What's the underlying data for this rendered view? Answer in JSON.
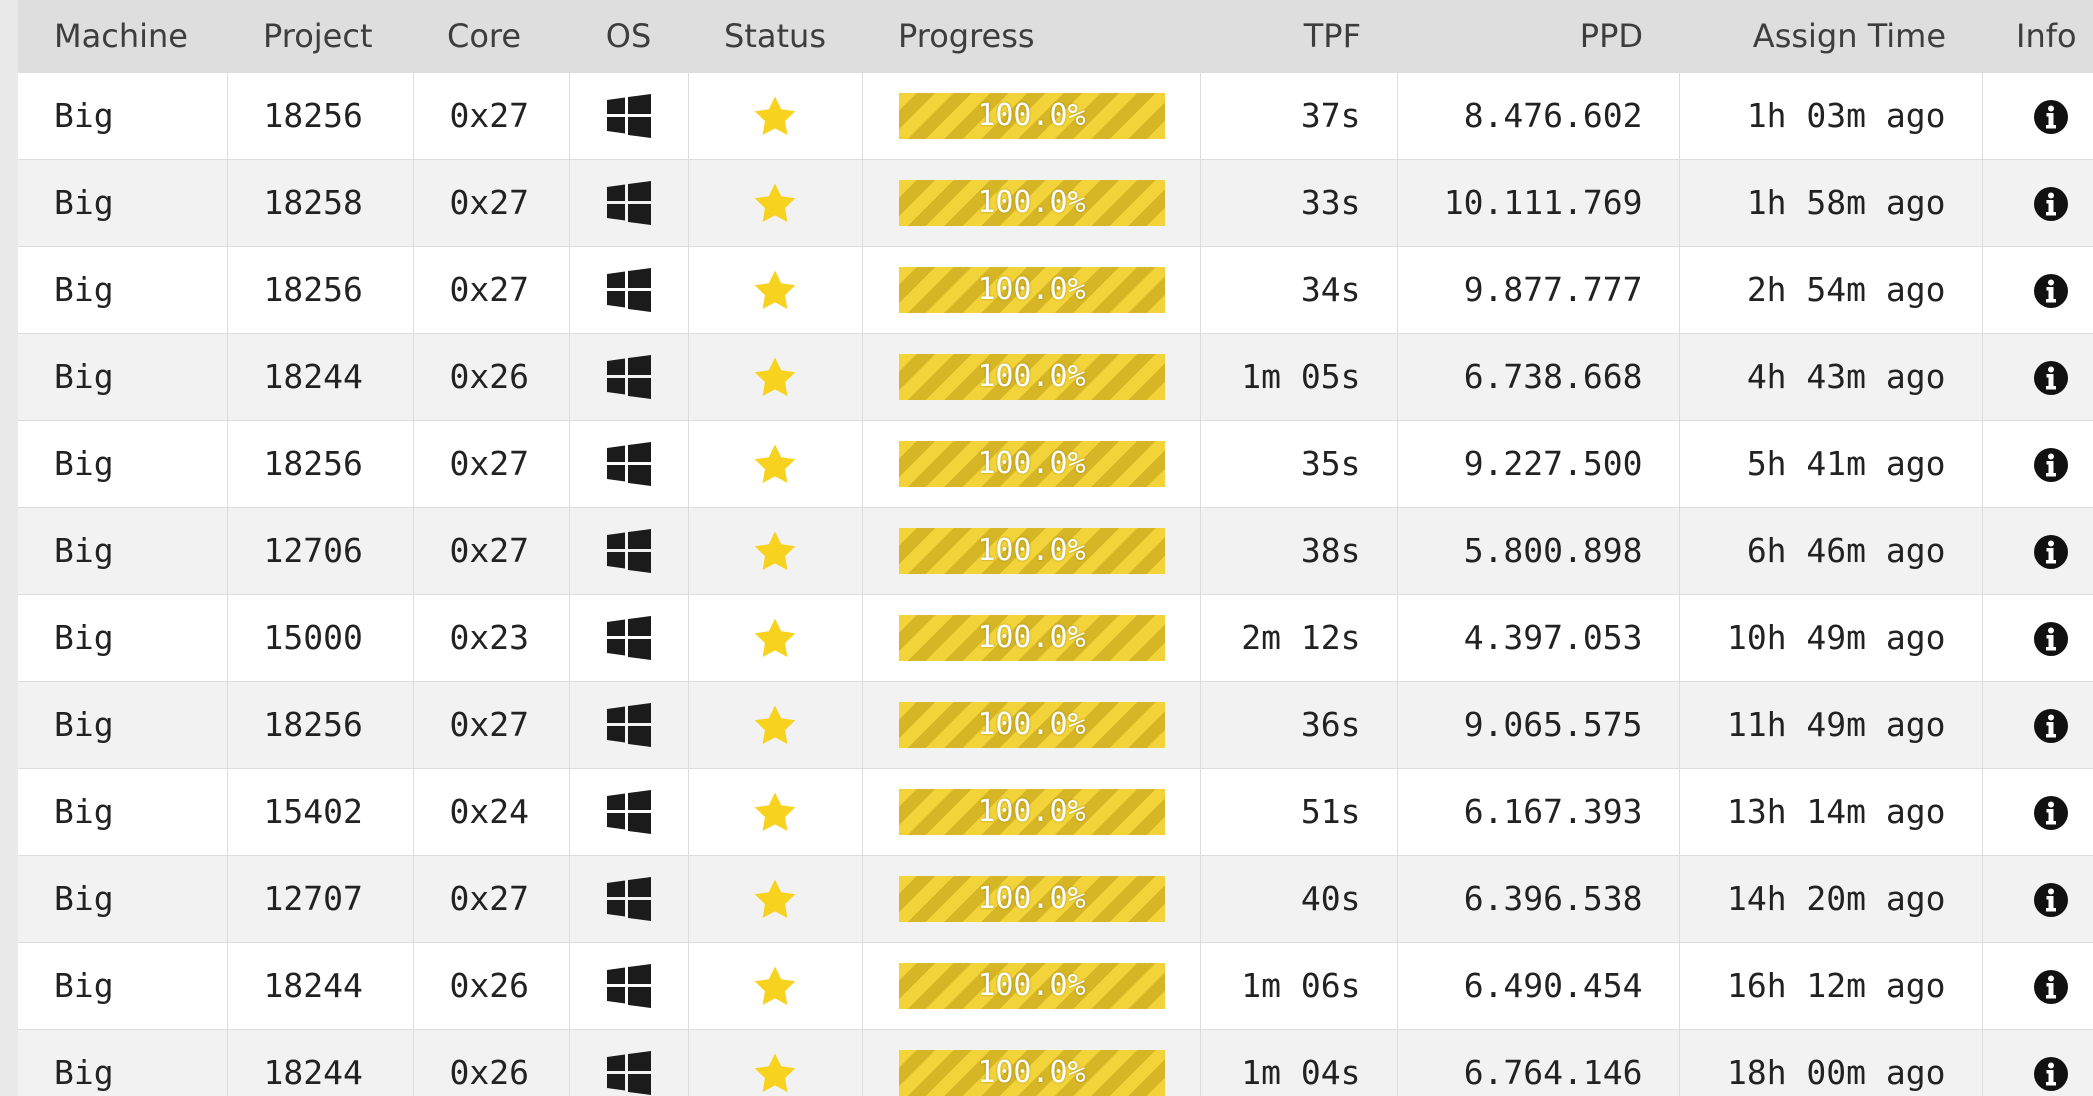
{
  "columns": {
    "machine": "Machine",
    "project": "Project",
    "core": "Core",
    "os": "OS",
    "status": "Status",
    "progress": "Progress",
    "tpf": "TPF",
    "ppd": "PPD",
    "assign_time": "Assign Time",
    "info": "Info"
  },
  "icons": {
    "os": "windows-icon",
    "status": "star-icon",
    "info": "info-icon"
  },
  "colors": {
    "star": "#f7d21e",
    "progress_light": "#f2d43a",
    "progress_dark": "#d6b625"
  },
  "rows": [
    {
      "machine": "Big",
      "project": "18256",
      "core": "0x27",
      "progress": "100.0%",
      "progress_value": 100,
      "tpf": "37s",
      "ppd": "8.476.602",
      "assign_time": "1h 03m ago"
    },
    {
      "machine": "Big",
      "project": "18258",
      "core": "0x27",
      "progress": "100.0%",
      "progress_value": 100,
      "tpf": "33s",
      "ppd": "10.111.769",
      "assign_time": "1h 58m ago"
    },
    {
      "machine": "Big",
      "project": "18256",
      "core": "0x27",
      "progress": "100.0%",
      "progress_value": 100,
      "tpf": "34s",
      "ppd": "9.877.777",
      "assign_time": "2h 54m ago"
    },
    {
      "machine": "Big",
      "project": "18244",
      "core": "0x26",
      "progress": "100.0%",
      "progress_value": 100,
      "tpf": "1m 05s",
      "ppd": "6.738.668",
      "assign_time": "4h 43m ago"
    },
    {
      "machine": "Big",
      "project": "18256",
      "core": "0x27",
      "progress": "100.0%",
      "progress_value": 100,
      "tpf": "35s",
      "ppd": "9.227.500",
      "assign_time": "5h 41m ago"
    },
    {
      "machine": "Big",
      "project": "12706",
      "core": "0x27",
      "progress": "100.0%",
      "progress_value": 100,
      "tpf": "38s",
      "ppd": "5.800.898",
      "assign_time": "6h 46m ago"
    },
    {
      "machine": "Big",
      "project": "15000",
      "core": "0x23",
      "progress": "100.0%",
      "progress_value": 100,
      "tpf": "2m 12s",
      "ppd": "4.397.053",
      "assign_time": "10h 49m ago"
    },
    {
      "machine": "Big",
      "project": "18256",
      "core": "0x27",
      "progress": "100.0%",
      "progress_value": 100,
      "tpf": "36s",
      "ppd": "9.065.575",
      "assign_time": "11h 49m ago"
    },
    {
      "machine": "Big",
      "project": "15402",
      "core": "0x24",
      "progress": "100.0%",
      "progress_value": 100,
      "tpf": "51s",
      "ppd": "6.167.393",
      "assign_time": "13h 14m ago"
    },
    {
      "machine": "Big",
      "project": "12707",
      "core": "0x27",
      "progress": "100.0%",
      "progress_value": 100,
      "tpf": "40s",
      "ppd": "6.396.538",
      "assign_time": "14h 20m ago"
    },
    {
      "machine": "Big",
      "project": "18244",
      "core": "0x26",
      "progress": "100.0%",
      "progress_value": 100,
      "tpf": "1m 06s",
      "ppd": "6.490.454",
      "assign_time": "16h 12m ago"
    },
    {
      "machine": "Big",
      "project": "18244",
      "core": "0x26",
      "progress": "100.0%",
      "progress_value": 100,
      "tpf": "1m 04s",
      "ppd": "6.764.146",
      "assign_time": "18h 00m ago"
    }
  ]
}
